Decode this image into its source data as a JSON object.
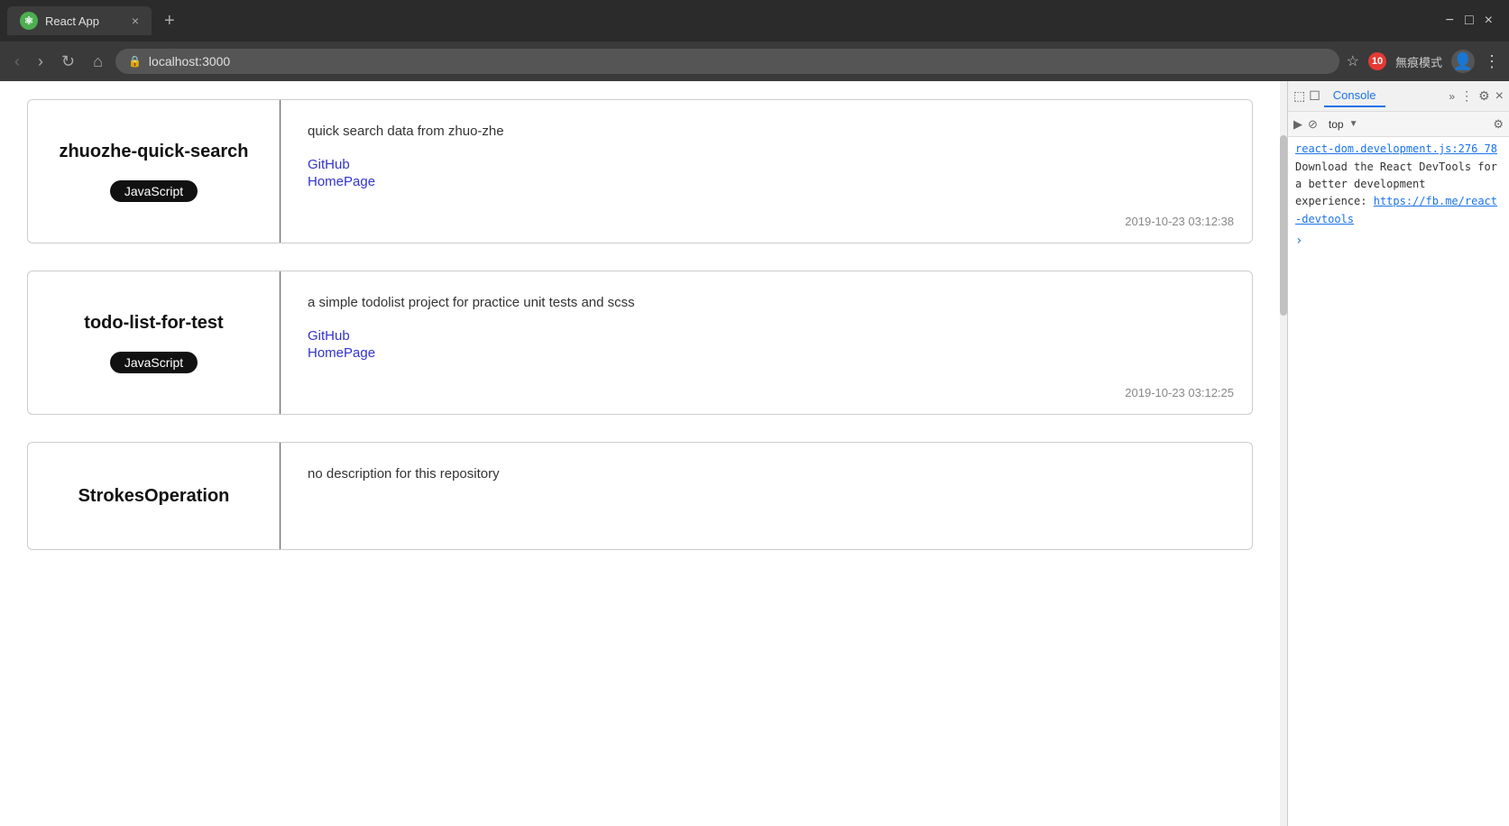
{
  "browser": {
    "tab_title": "React App",
    "tab_close": "×",
    "tab_new": "+",
    "url": "localhost:3000",
    "minimize": "−",
    "maximize": "□",
    "close": "×"
  },
  "toolbar": {
    "back": "‹",
    "forward": "›",
    "reload": "↻",
    "home": "⌂",
    "extensions_label": "無痕模式",
    "badge_count": "10",
    "more": "⋮"
  },
  "repos": [
    {
      "name": "zhuozhe-quick-search",
      "badge": "JavaScript",
      "description": "quick search data from zhuo-zhe",
      "github_label": "GitHub",
      "homepage_label": "HomePage",
      "timestamp": "2019-10-23 03:12:38"
    },
    {
      "name": "todo-list-for-test",
      "badge": "JavaScript",
      "description": "a simple todolist project for practice unit tests and scss",
      "github_label": "GitHub",
      "homepage_label": "HomePage",
      "timestamp": "2019-10-23 03:12:25"
    },
    {
      "name": "StrokesOperation",
      "badge": null,
      "description": "no description for this repository",
      "github_label": null,
      "homepage_label": null,
      "timestamp": null
    }
  ],
  "devtools": {
    "tabs": [
      "Console"
    ],
    "tab_more": "»",
    "close_label": "×",
    "settings_label": "⚙",
    "inspect_label": "⬚",
    "device_label": "☐",
    "sub_toolbar_play": "▶",
    "sub_toolbar_ban": "⊘",
    "top_label": "top",
    "dropdown": "▼",
    "file_link": "react-dom.development.js:276 78",
    "message": "Download the React DevTools for a better development experience:",
    "ext_link": "https://fb.me/react-devtools",
    "caret": "›"
  }
}
